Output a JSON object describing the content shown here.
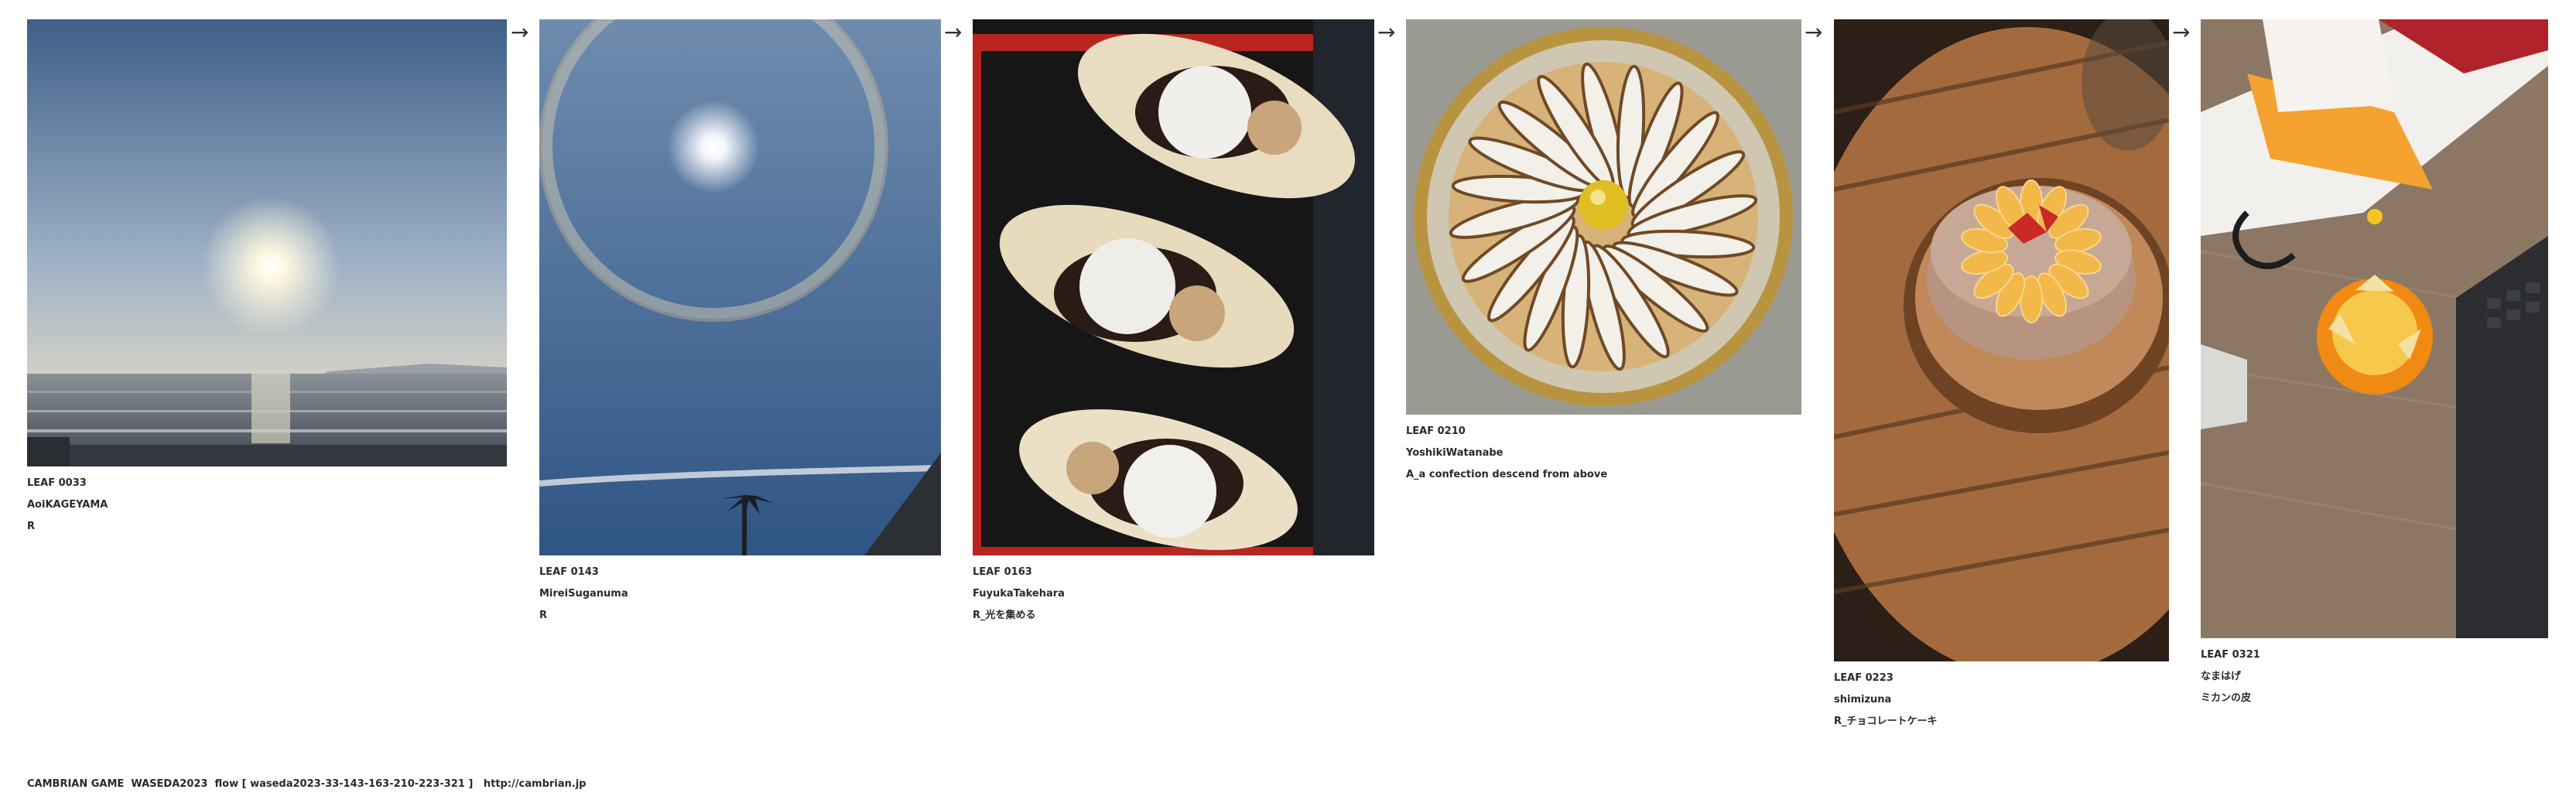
{
  "arrow_glyph": "→",
  "leaves": [
    {
      "id": "LEAF 0033",
      "author": "AoiKAGEYAMA",
      "title": "R"
    },
    {
      "id": "LEAF 0143",
      "author": "MireiSuganuma",
      "title": "R"
    },
    {
      "id": "LEAF 0163",
      "author": "FuyukaTakehara",
      "title": "R_光を集める"
    },
    {
      "id": "LEAF 0210",
      "author": "YoshikiWatanabe",
      "title": "A_a confection descend from above"
    },
    {
      "id": "LEAF 0223",
      "author": "shimizuna",
      "title": "R_チョコレートケーキ"
    },
    {
      "id": "LEAF 0321",
      "author": "なまはげ",
      "title": "ミカンの皮"
    }
  ],
  "footer": {
    "text": "CAMBRIAN GAME  WASEDA2023  flow [ waseda2023-33-143-163-210-223-321 ]   http://cambrian.jp"
  }
}
